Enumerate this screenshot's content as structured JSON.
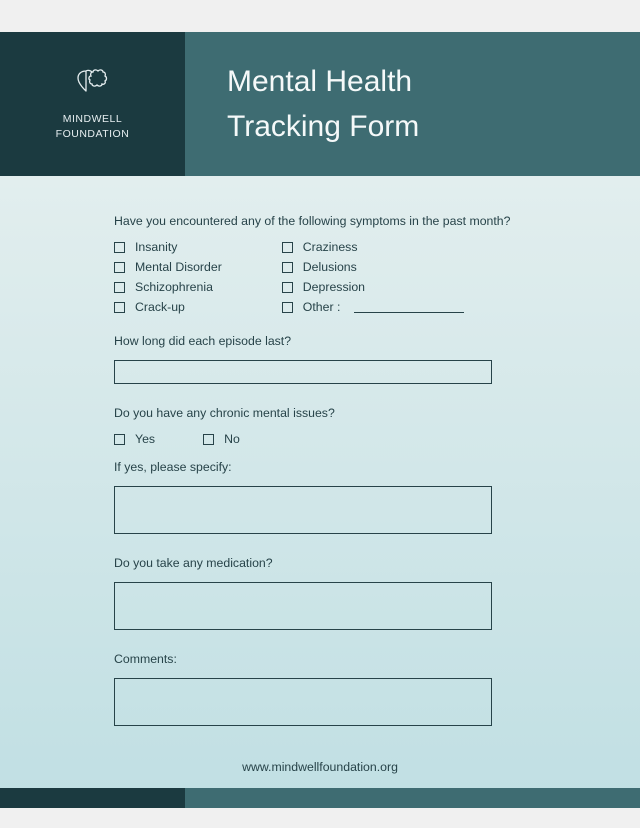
{
  "org": {
    "line1": "MINDWELL",
    "line2": "FOUNDATION"
  },
  "title": "Mental Health\nTracking Form",
  "q1": "Have you encountered any of the following symptoms in the past month?",
  "symptoms_col1": [
    "Insanity",
    "Mental Disorder",
    "Schizophrenia",
    "Crack-up"
  ],
  "symptoms_col2": [
    "Craziness",
    "Delusions",
    "Depression"
  ],
  "other_label": "Other :",
  "q2": "How long did each episode last?",
  "q3": "Do you have any chronic mental issues?",
  "yes": "Yes",
  "no": "No",
  "q3b": "If yes, please specify:",
  "q4": "Do you take any medication?",
  "q5": "Comments:",
  "footer": "www.mindwellfoundation.org"
}
